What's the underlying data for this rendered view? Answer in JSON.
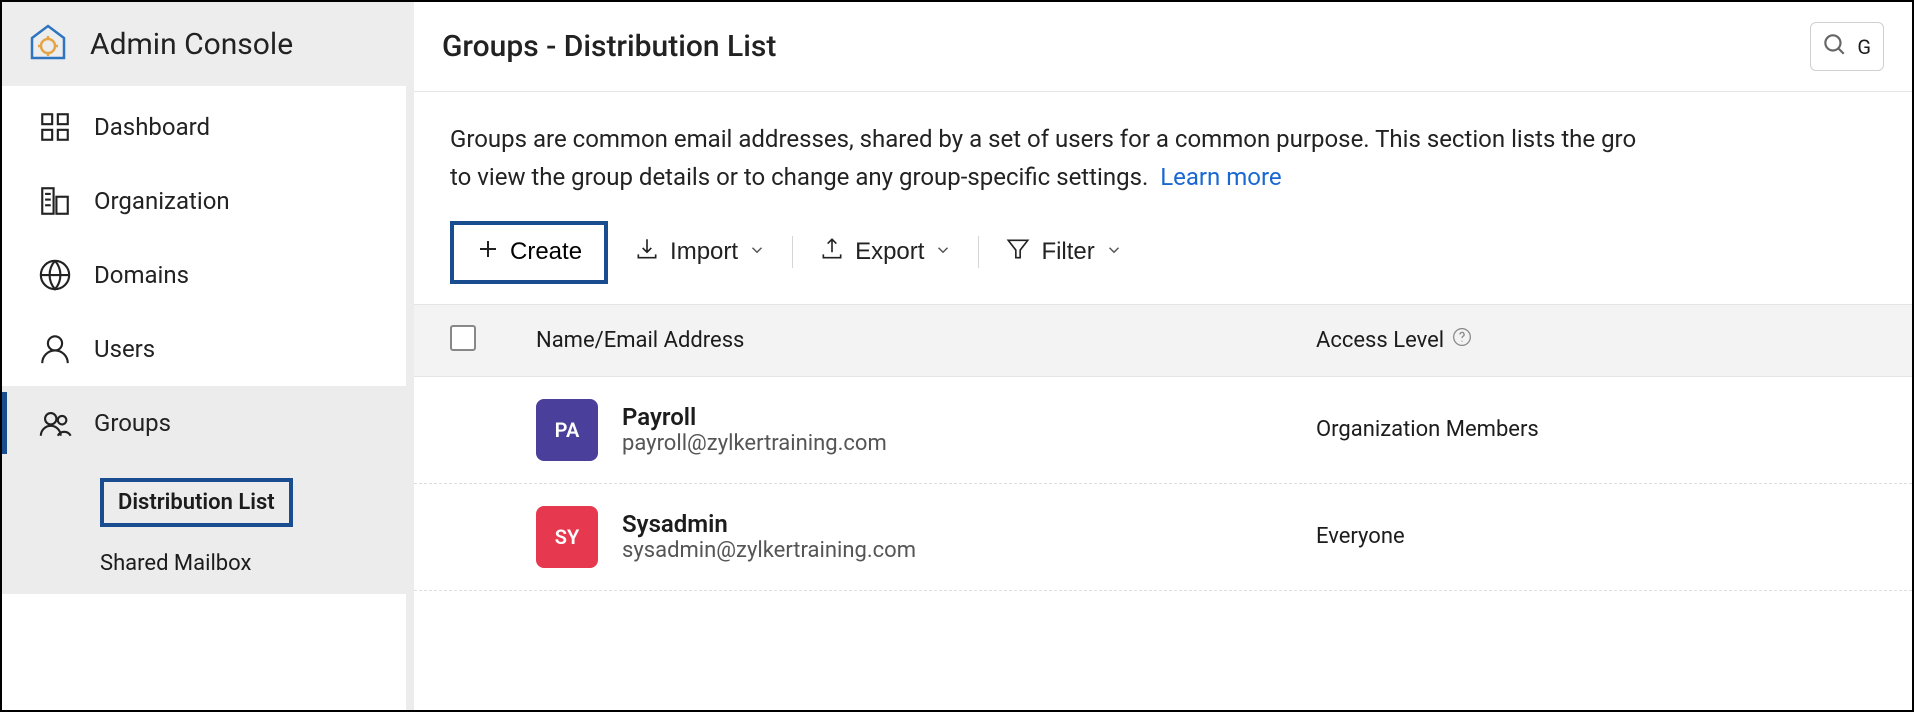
{
  "sidebar": {
    "title": "Admin Console",
    "items": [
      {
        "key": "dashboard",
        "label": "Dashboard"
      },
      {
        "key": "organization",
        "label": "Organization"
      },
      {
        "key": "domains",
        "label": "Domains"
      },
      {
        "key": "users",
        "label": "Users"
      },
      {
        "key": "groups",
        "label": "Groups",
        "active": true
      }
    ],
    "groups_sub": [
      {
        "label": "Distribution List",
        "highlighted": true
      },
      {
        "label": "Shared Mailbox",
        "highlighted": false
      }
    ]
  },
  "header": {
    "title": "Groups - Distribution List"
  },
  "description": {
    "text_part1": "Groups are common email addresses, shared by a set of users for a common purpose. This section lists the gro",
    "text_part2": "to view the group details or to change any group-specific settings.",
    "learn_more": "Learn more"
  },
  "toolbar": {
    "create": "Create",
    "import": "Import",
    "export": "Export",
    "filter": "Filter"
  },
  "table": {
    "columns": {
      "name": "Name/Email Address",
      "access": "Access Level"
    },
    "rows": [
      {
        "initials": "PA",
        "color": "#4a3f9b",
        "name": "Payroll",
        "email": "payroll@zylkertraining.com",
        "access": "Organization Members"
      },
      {
        "initials": "SY",
        "color": "#e63950",
        "name": "Sysadmin",
        "email": "sysadmin@zylkertraining.com",
        "access": "Everyone"
      }
    ]
  }
}
